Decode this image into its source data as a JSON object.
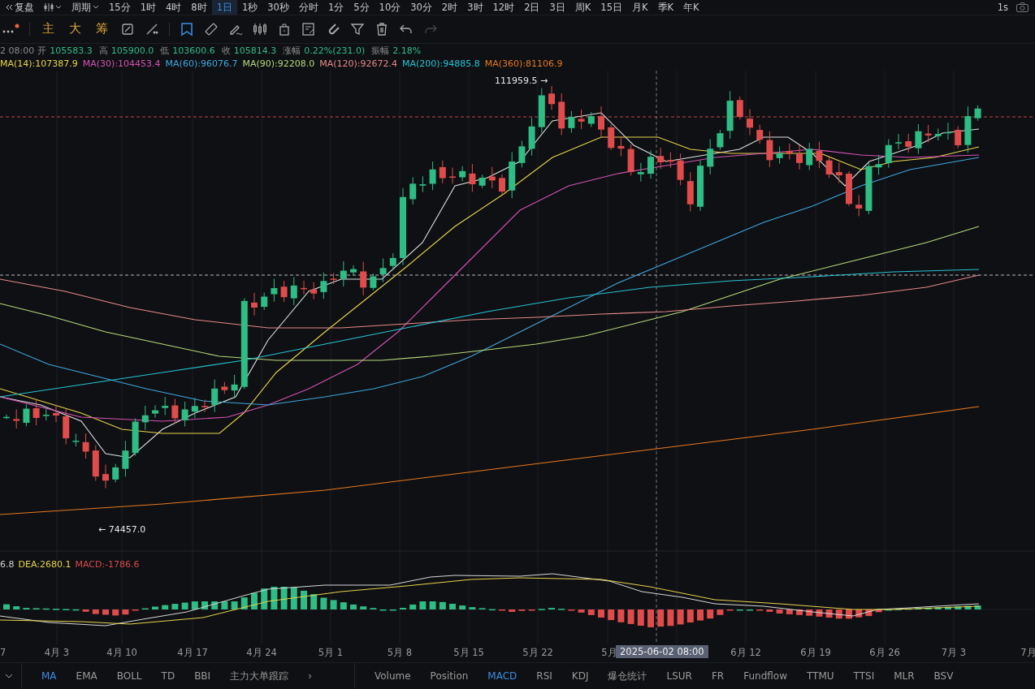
{
  "top_bar": {
    "replay": "复盘",
    "period_menu": "周期",
    "periods": [
      {
        "label": "15分",
        "selected": false
      },
      {
        "label": "1时",
        "selected": false
      },
      {
        "label": "4时",
        "selected": false
      },
      {
        "label": "8时",
        "selected": false
      },
      {
        "label": "1日",
        "selected": true
      },
      {
        "label": "1秒",
        "selected": false
      },
      {
        "label": "30秒",
        "selected": false
      },
      {
        "label": "分时",
        "selected": false
      },
      {
        "label": "1分",
        "selected": false
      },
      {
        "label": "5分",
        "selected": false
      },
      {
        "label": "10分",
        "selected": false
      },
      {
        "label": "30分",
        "selected": false
      },
      {
        "label": "2时",
        "selected": false
      },
      {
        "label": "3时",
        "selected": false
      },
      {
        "label": "12时",
        "selected": false
      },
      {
        "label": "2日",
        "selected": false
      },
      {
        "label": "3日",
        "selected": false
      },
      {
        "label": "周K",
        "selected": false
      },
      {
        "label": "15日",
        "selected": false
      },
      {
        "label": "月K",
        "selected": false
      },
      {
        "label": "季K",
        "selected": false
      },
      {
        "label": "年K",
        "selected": false
      }
    ],
    "interval": "1s"
  },
  "toolbar": {
    "quick_labels": [
      "主",
      "大",
      "筹"
    ]
  },
  "ohlc": {
    "time": "2 08:00",
    "fields": [
      {
        "label": "开",
        "value": "105583.3"
      },
      {
        "label": "高",
        "value": "105900.0"
      },
      {
        "label": "低",
        "value": "103600.6"
      },
      {
        "label": "收",
        "value": "105814.3"
      },
      {
        "label": "涨幅",
        "value": "0.22%(231.0)"
      },
      {
        "label": "振幅",
        "value": "2.18%"
      }
    ]
  },
  "ma_legend": [
    {
      "text": "MA(14):107387.9",
      "color": "#e8d44d"
    },
    {
      "text": "MA(30):104453.4",
      "color": "#d553b5"
    },
    {
      "text": "MA(60):96076.7",
      "color": "#3fa7e0"
    },
    {
      "text": "MA(90):92208.0",
      "color": "#b6d97a"
    },
    {
      "text": "MA(120):92672.4",
      "color": "#e58a8a"
    },
    {
      "text": "MA(200):94885.8",
      "color": "#27c3d4"
    },
    {
      "text": "MA(360):81106.9",
      "color": "#e67a1f"
    }
  ],
  "chart": {
    "high_marker": "111959.5 →",
    "low_marker": "← 74457.0"
  },
  "macd_legend": [
    {
      "text": "6.8",
      "color": "#d0d0d0"
    },
    {
      "text": "DEA:2680.1",
      "color": "#e8d44d"
    },
    {
      "text": "MACD:-1786.6",
      "color": "#d84a4a"
    }
  ],
  "x_axis": {
    "labels": [
      "7",
      "4月 3",
      "4月 10",
      "4月 17",
      "4月 24",
      "5月 1",
      "5月 8",
      "5月 15",
      "5月 22",
      "5月",
      "6月 12",
      "6月 19",
      "6月 26",
      "7月 3",
      "7月"
    ],
    "crosshair_label": "2025-06-02 08:00"
  },
  "indicator_tabs": {
    "main": [
      {
        "label": "MA",
        "selected": true
      },
      {
        "label": "EMA",
        "selected": false
      },
      {
        "label": "BOLL",
        "selected": false
      },
      {
        "label": "TD",
        "selected": false
      },
      {
        "label": "BBI",
        "selected": false
      },
      {
        "label": "主力大单跟踪",
        "selected": false
      }
    ],
    "more": "›",
    "sub": [
      {
        "label": "Volume",
        "selected": false
      },
      {
        "label": "Position",
        "selected": false
      },
      {
        "label": "MACD",
        "selected": true
      },
      {
        "label": "RSI",
        "selected": false
      },
      {
        "label": "KDJ",
        "selected": false
      },
      {
        "label": "爆仓统计",
        "selected": false
      },
      {
        "label": "LSUR",
        "selected": false
      },
      {
        "label": "FR",
        "selected": false
      },
      {
        "label": "Fundflow",
        "selected": false
      },
      {
        "label": "TTMU",
        "selected": false
      },
      {
        "label": "TTSI",
        "selected": false
      },
      {
        "label": "MLR",
        "selected": false
      },
      {
        "label": "BSV",
        "selected": false
      }
    ]
  }
}
